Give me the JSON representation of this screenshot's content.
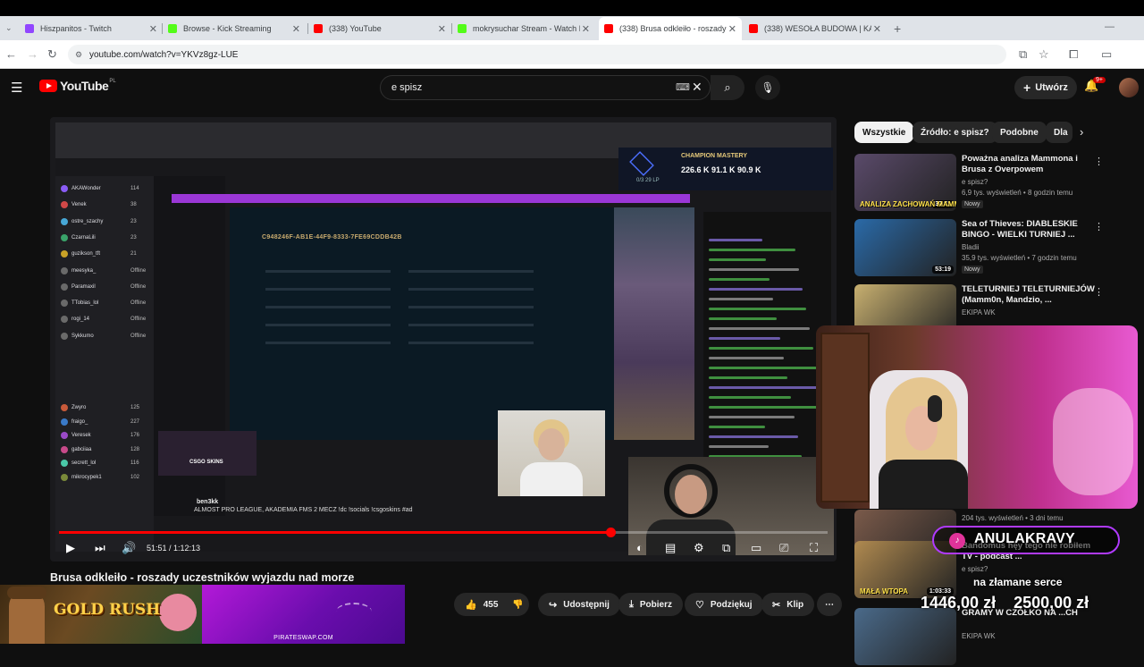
{
  "browser": {
    "tabs": [
      {
        "title": "Hiszpanitos - Twitch",
        "color": "#9146ff",
        "active": false
      },
      {
        "title": "Browse - Kick Streaming",
        "color": "#53fc18",
        "active": false
      },
      {
        "title": "(338) YouTube",
        "color": "#ff0000",
        "active": false
      },
      {
        "title": "mokrysuchar Stream - Watch Li",
        "color": "#53fc18",
        "active": false
      },
      {
        "title": "(338) Brusa odkleiło - roszady u",
        "color": "#ff0000",
        "active": true
      },
      {
        "title": "(338) WESOŁA BUDOWA | KAS",
        "color": "#ff0000",
        "active": false
      }
    ],
    "new_tab": "+",
    "url": "youtube.com/watch?v=YKVz8gz-LUE"
  },
  "youtube": {
    "logo": "YouTube",
    "country": "PL",
    "search_value": "e spisz",
    "create_label": "Utwórz",
    "notif_count": "9+"
  },
  "player": {
    "time": "51:51 / 1:12:13",
    "progress": 0.718,
    "inner": {
      "game_code": "C948246F-AB1E-44F9-8333-7FE69CDDB42B",
      "mastery_title": "CHAMPION MASTERY",
      "mastery_nums": "226.6 K   91.1 K   90.9 K",
      "lp": "0/3 29 LP",
      "streamer": "ben3kk",
      "stream_title": "ALMOST PRO LEAGUE, AKADEMIA FMS 2 MECZ !dc !socials !csgoskins #ad",
      "skins": "CSGO SKINS",
      "sidebar": [
        {
          "name": "AKAWonder",
          "count": "114"
        },
        {
          "name": "Venek",
          "count": "38"
        },
        {
          "name": "ostre_szachy",
          "count": "23"
        },
        {
          "name": "CzarnaLili",
          "count": "23"
        },
        {
          "name": "guzikson_tft",
          "count": "21"
        },
        {
          "name": "meesyka_",
          "count": "Offline"
        },
        {
          "name": "Paramaxil",
          "count": "Offline"
        },
        {
          "name": "TTobias_lol",
          "count": "Offline"
        },
        {
          "name": "rogi_14",
          "count": "Offline"
        },
        {
          "name": "Sykkumo",
          "count": "Offline"
        },
        {
          "name": "Zwyro",
          "count": "125"
        },
        {
          "name": "fraigo_",
          "count": "227"
        },
        {
          "name": "Veresek",
          "count": "176"
        },
        {
          "name": "gabciiaa",
          "count": "128"
        },
        {
          "name": "secrett_lol",
          "count": "116"
        },
        {
          "name": "mikrocypek1",
          "count": "102"
        }
      ]
    }
  },
  "video": {
    "title": "Brusa odkleiło - roszady uczestników wyjazdu nad morze",
    "likes": "455",
    "share": "Udostępnij",
    "download": "Pobierz",
    "thanks": "Podziękuj",
    "clip": "Klip"
  },
  "banners": {
    "goldrush": "GOLD RUSH",
    "pirateswap": "PIRATESWAP.COM"
  },
  "rail": {
    "chips": [
      "Wszystkie",
      "Źródło: e spisz?",
      "Podobne",
      "Dla"
    ],
    "items": [
      {
        "title": "Poważna analiza Mammona i Brusa z Overpowem",
        "channel": "e spisz?",
        "meta": "6,9 tys. wyświetleń • 8 godzin temu",
        "badge": "Nowy",
        "duration": "30:51",
        "thumb": "#5a4a6a"
      },
      {
        "title": "Sea of Thieves: DIABLESKIE BINGO - WIELKI TURNIEJ ...",
        "channel": "Bladii",
        "meta": "35,9 tys. wyświetleń • 7 godzin temu",
        "badge": "Nowy",
        "duration": "53:19",
        "thumb": "#2a6aa8"
      },
      {
        "title": "TELETURNIEJ TELETURNIEJÓW (Mamm0n, Mandzio, ...",
        "channel": "EKIPA WK",
        "meta": "",
        "badge": "",
        "duration": "",
        "thumb": "#c8b070"
      },
      {
        "title": "",
        "channel": "",
        "meta": "204 tys. wyświetleń • 3 dni temu",
        "badge": "",
        "duration": "55:55",
        "thumb": "#7a5a4a"
      },
      {
        "title": "Bandomus hęy tego nie robiłem TV - podcast ...",
        "channel": "e spisz?",
        "meta": "",
        "badge": "",
        "duration": "1:03:33",
        "thumb": "#b08a50"
      },
      {
        "title": "GRAMY W CZÓŁKO NA ...CH",
        "channel": "EKIPA WK",
        "meta": "",
        "badge": "",
        "duration": "",
        "thumb": "#4a6a8a"
      }
    ],
    "thumb_texts": [
      "ANALIZA ZACHOWAŃ MAMMONA i B",
      "MAŁA WTOPA"
    ]
  },
  "overlay": {
    "handle": "ANULAKRAVY",
    "donate_label": "na złamane serce",
    "donate_current": "1446,00 zł",
    "donate_goal": "2500,00 zł"
  }
}
